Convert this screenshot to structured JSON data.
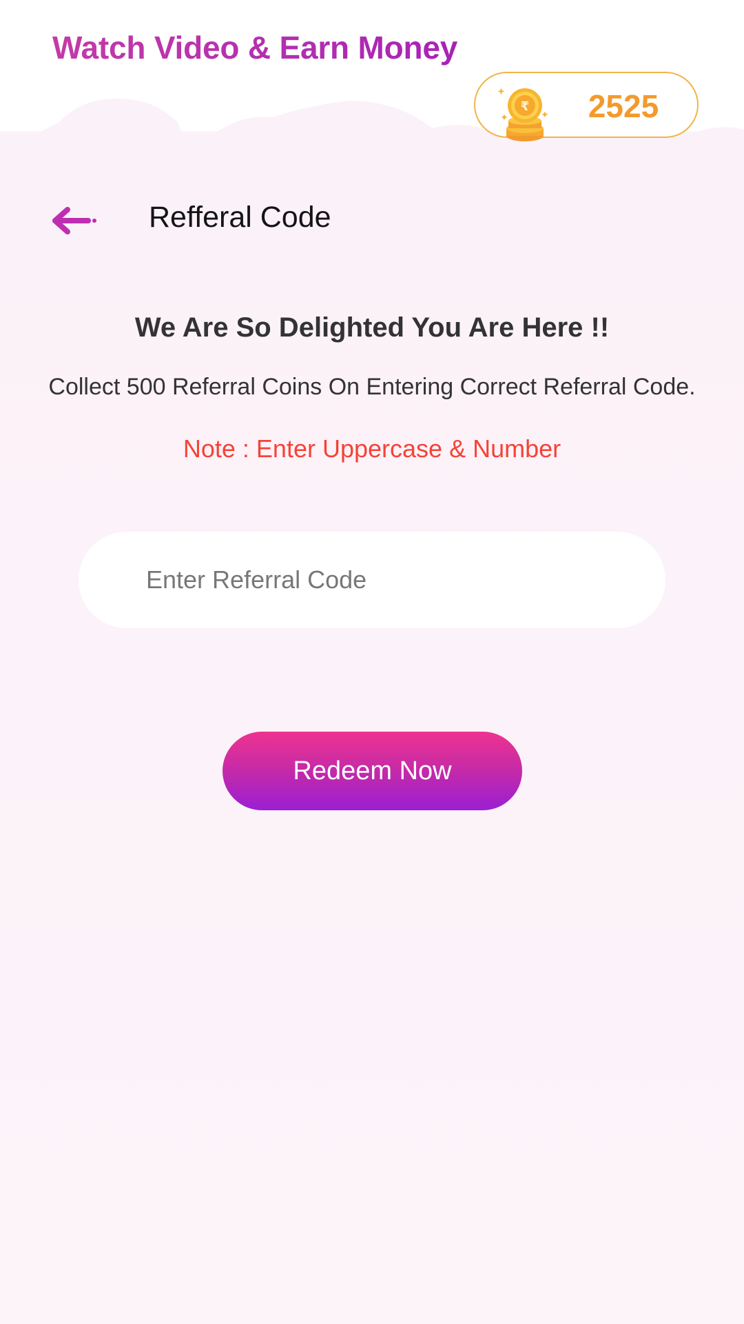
{
  "app": {
    "title": "Watch Video & Earn Money"
  },
  "wallet": {
    "coin_count": "2525",
    "icon": "rupee-coin-stack-icon"
  },
  "header": {
    "back_icon": "arrow-left-icon",
    "title": "Refferal Code"
  },
  "content": {
    "headline": "We Are So Delighted You Are Here !!",
    "description": "Collect 500 Referral Coins On Entering Correct Referral Code.",
    "note": "Note : Enter Uppercase & Number"
  },
  "form": {
    "referral_input": {
      "value": "",
      "placeholder": "Enter Referral Code"
    },
    "submit_label": "Redeem Now"
  },
  "colors": {
    "title_gradient": [
      "#c43aa6",
      "#a822b4"
    ],
    "coin_text": "#f39a2c",
    "note_text": "#f44336",
    "button_gradient": [
      "#ee3390",
      "#9b1fd3"
    ],
    "background": "#fdf4fa"
  }
}
